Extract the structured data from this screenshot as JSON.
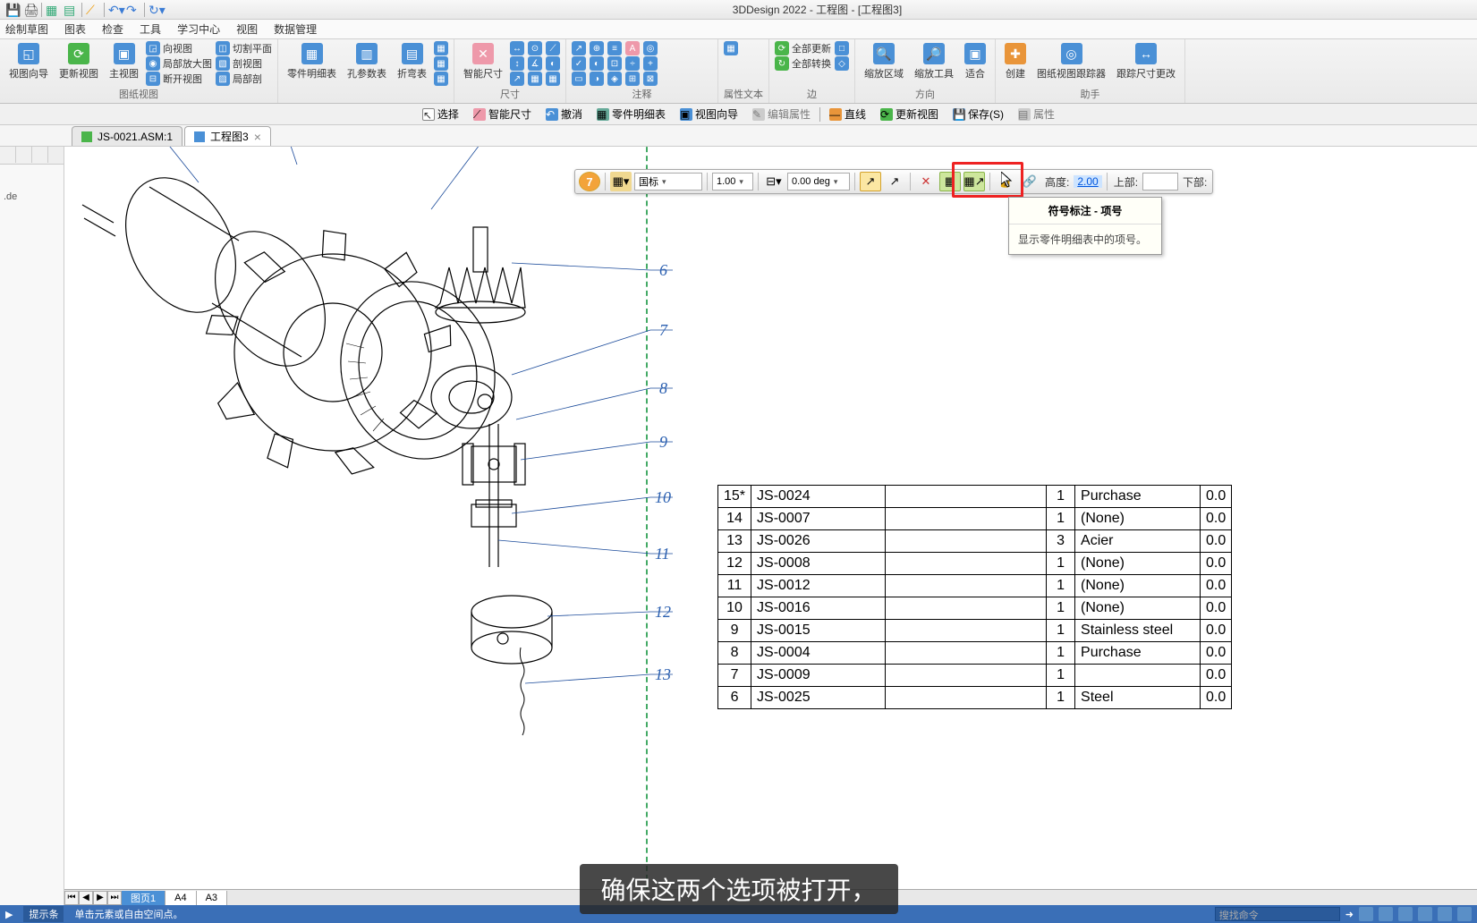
{
  "title": "3DDesign 2022 - 工程图 - [工程图3]",
  "menu": [
    "绘制草图",
    "图表",
    "检查",
    "工具",
    "学习中心",
    "视图",
    "数据管理"
  ],
  "ribbon_groups": [
    {
      "label": "图纸视图",
      "buttons": [
        {
          "t": "视图向导"
        },
        {
          "t": "更新视图"
        },
        {
          "t": "主视图"
        }
      ],
      "side": [
        {
          "t": "向视图"
        },
        {
          "t": "局部放大图"
        },
        {
          "t": "断开视图"
        },
        {
          "t": "切割平面"
        },
        {
          "t": "剖视图"
        },
        {
          "t": "局部剖"
        }
      ]
    },
    {
      "label": "",
      "buttons": [
        {
          "t": "零件明细表"
        },
        {
          "t": "孔参数表"
        },
        {
          "t": "折弯表"
        }
      ]
    },
    {
      "label": "尺寸",
      "buttons": [
        {
          "t": "智能尺寸"
        }
      ]
    },
    {
      "label": "注释",
      "buttons": []
    },
    {
      "label": "属性文本",
      "buttons": []
    },
    {
      "label": "边",
      "buttons": [
        {
          "t": "全部更新"
        },
        {
          "t": "全部转换"
        }
      ]
    },
    {
      "label": "方向",
      "buttons": [
        {
          "t": "缩放区域"
        },
        {
          "t": "缩放工具"
        },
        {
          "t": "适合"
        }
      ]
    },
    {
      "label": "助手",
      "buttons": [
        {
          "t": "创建"
        },
        {
          "t": "图纸视图跟踪器"
        },
        {
          "t": "跟踪尺寸更改"
        }
      ]
    }
  ],
  "context_toolbar": [
    {
      "t": "选择",
      "icon": "↖"
    },
    {
      "t": "智能尺寸",
      "icon": "⟋"
    },
    {
      "t": "撤消",
      "icon": "↶"
    },
    {
      "t": "零件明细表",
      "icon": "▦"
    },
    {
      "t": "视图向导",
      "icon": "▣"
    },
    {
      "t": "编辑属性",
      "icon": "✎",
      "disabled": true
    },
    {
      "t": "直线",
      "icon": "—"
    },
    {
      "t": "更新视图",
      "icon": "⟳"
    },
    {
      "t": "保存(S)",
      "icon": "💾"
    },
    {
      "t": "属性",
      "icon": "▤",
      "disabled": true
    }
  ],
  "doc_tabs": [
    {
      "label": "JS-0021.ASM:1",
      "active": false
    },
    {
      "label": "工程图3",
      "active": true
    }
  ],
  "balloons": [
    "6",
    "7",
    "8",
    "9",
    "10",
    "11",
    "12",
    "13"
  ],
  "bom": [
    {
      "n": "15*",
      "code": "JS-0024",
      "qty": "1",
      "mat": "Purchase",
      "w": "0.0"
    },
    {
      "n": "14",
      "code": "JS-0007",
      "qty": "1",
      "mat": "(None)",
      "w": "0.0"
    },
    {
      "n": "13",
      "code": "JS-0026",
      "qty": "3",
      "mat": "Acier",
      "w": "0.0"
    },
    {
      "n": "12",
      "code": "JS-0008",
      "qty": "1",
      "mat": "(None)",
      "w": "0.0"
    },
    {
      "n": "11",
      "code": "JS-0012",
      "qty": "1",
      "mat": "(None)",
      "w": "0.0"
    },
    {
      "n": "10",
      "code": "JS-0016",
      "qty": "1",
      "mat": "(None)",
      "w": "0.0"
    },
    {
      "n": "9",
      "code": "JS-0015",
      "qty": "1",
      "mat": "Stainless steel",
      "w": "0.0"
    },
    {
      "n": "8",
      "code": "JS-0004",
      "qty": "1",
      "mat": "Purchase",
      "w": "0.0"
    },
    {
      "n": "7",
      "code": "JS-0009",
      "qty": "1",
      "mat": "",
      "w": "0.0"
    },
    {
      "n": "6",
      "code": "JS-0025",
      "qty": "1",
      "mat": "Steel",
      "w": "0.0"
    }
  ],
  "floating": {
    "step_badge": "7",
    "std": "国标",
    "scale": "1.00",
    "angle": "0.00 deg",
    "height_label": "高度:",
    "height_val": "2.00",
    "top_label": "上部:",
    "bottom_label": "下部:"
  },
  "tooltip": {
    "title": "符号标注 - 项号",
    "body": "显示零件明细表中的项号。"
  },
  "sheet_tabs": {
    "active": "图页1",
    "others": [
      "A4",
      "A3"
    ]
  },
  "status": {
    "hint_label": "提示条",
    "hint": "单击元素或自由空间点。",
    "search_ph": "搜找命令"
  },
  "subtitle": "确保这两个选项被打开，",
  "left_text": ".de"
}
